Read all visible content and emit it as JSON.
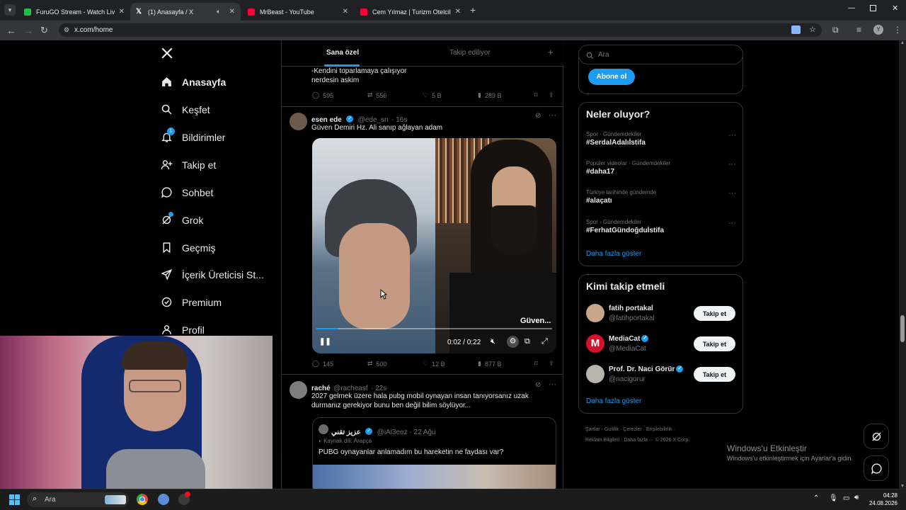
{
  "browser": {
    "tabs": [
      {
        "title": "FuruGO Stream - Watch Live on",
        "favicon_color": "#1fbf4a",
        "active": false
      },
      {
        "title": "(1) Anasayfa / X",
        "favicon_color": "#ffffff",
        "active": true
      },
      {
        "title": "MrBeast - YouTube",
        "favicon_color": "#ff0033",
        "active": false
      },
      {
        "title": "Cem Yılmaz | Turizm Otelcilik -",
        "favicon_color": "#ff0033",
        "active": false
      }
    ],
    "url": "x.com/home",
    "profile_initial": "Y"
  },
  "sidebar": {
    "items": [
      {
        "label": "Anasayfa",
        "icon": "home-icon",
        "active": true
      },
      {
        "label": "Keşfet",
        "icon": "search-icon"
      },
      {
        "label": "Bildirimler",
        "icon": "bell-icon",
        "badge": "1"
      },
      {
        "label": "Takip et",
        "icon": "add-user-icon"
      },
      {
        "label": "Sohbet",
        "icon": "chat-icon"
      },
      {
        "label": "Grok",
        "icon": "grok-icon"
      },
      {
        "label": "Geçmiş",
        "icon": "bookmark-icon"
      },
      {
        "label": "İçerik Üreticisi St...",
        "icon": "rocket-icon"
      },
      {
        "label": "Premium",
        "icon": "verified-icon"
      },
      {
        "label": "Profil",
        "icon": "profile-icon"
      }
    ]
  },
  "feed": {
    "tabs": [
      "Sana özel",
      "Takip ediliyor"
    ],
    "prev_tweet": {
      "text_lines": [
        "-Kendini toparlamaya çalışıyor",
        "nerdesin askim"
      ],
      "replies": "595",
      "reposts": "556",
      "likes": "5 B",
      "views": "289 B"
    },
    "tweet1": {
      "name": "esen ede",
      "handle": "@ede_sn",
      "time": "· 16s",
      "text": "Güven Demiri Hz. Ali sanıp ağlayan adam",
      "video_caption": "Güven...",
      "video_time": "0:02 / 0:22",
      "video_progress": 0.09,
      "replies": "145",
      "reposts": "500",
      "likes": "12 B",
      "views": "877 B"
    },
    "tweet2": {
      "name": "raché",
      "handle": "@racheasf",
      "time": "· 22s",
      "text_lines": [
        "2027 gelmek üzere hala pubg mobil oynayan insan tanıyorsanız uzak",
        "durmanız gerekiyor bunu ben değil bilim söylüyor..."
      ],
      "quote": {
        "name": "عزيز تقني",
        "handle": "@iAl3eez · 22 Ağu",
        "source": "Kaynak dili: Arapça",
        "text": "PUBG oynayanlar anlamadım bu hareketin ne faydası var?"
      }
    }
  },
  "right": {
    "search_placeholder": "Ara",
    "subscribe_label": "Abone ol",
    "trends_title": "Neler oluyor?",
    "trends": [
      {
        "meta": "Spor · Gündemdekiler",
        "tag": "#SerdalAdalıİstifa"
      },
      {
        "meta": "Popüler videolar · Gündemdekiler",
        "tag": "#daha17"
      },
      {
        "meta": "Türkiye tarihinde gündemde",
        "tag": "#alaçatı"
      },
      {
        "meta": "Spor · Gündemdekiler",
        "tag": "#FerhatGündoğduİstifa"
      }
    ],
    "show_more": "Daha fazla göster",
    "who_title": "Kimi takip etmeli",
    "who": [
      {
        "name": "fatih portakal",
        "handle": "@fatihportakal",
        "verified": false,
        "avatar_color": "#c9a58a"
      },
      {
        "name": "MediaCat",
        "handle": "@MediaCat",
        "verified": true,
        "avatar_color": "#d3132a"
      },
      {
        "name": "Prof. Dr. Naci Görür",
        "handle": "@nacigorur",
        "verified": true,
        "avatar_color": "#b9b3ad"
      }
    ],
    "follow_label": "Takip et",
    "who_more": "Daha fazla göster",
    "footer_line1": "Şartlar · Gizlilik · Çerezler · Erişilebilirlik ·",
    "footer_line2": "Reklam Bilgileri · Daha fazla ··· © 2026 X Corp."
  },
  "watermark": {
    "title": "Windows'u Etkinleştir",
    "subtitle": "Windows'u etkinleştirmek için Ayarlar'a gidin."
  },
  "taskbar": {
    "search_placeholder": "Ara",
    "time": "04:28",
    "date": "24.08.2026"
  }
}
